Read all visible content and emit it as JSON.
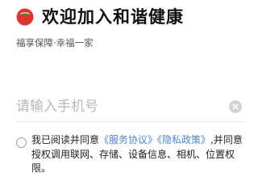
{
  "header": {
    "logo_icon": "pomegranate-logo-icon",
    "title": "欢迎加入和谐健康",
    "subtitle": "福享保障·幸福一家"
  },
  "login": {
    "phone_placeholder": "请输入手机号",
    "phone_value": "",
    "clear_icon": "close-circle-icon"
  },
  "agreement": {
    "prefix": "我已阅读并同意",
    "service_link": "《服务协议》",
    "privacy_link": "《隐私政策》",
    "suffix": ",并同意授权调用联网、存储、设备信息、相机、位置权限。",
    "checked": false
  },
  "colors": {
    "accent_red": "#e0352f",
    "logo_green": "#2f9a4a",
    "link_blue": "#4e86c2",
    "placeholder_gray": "#b8b8b8"
  }
}
